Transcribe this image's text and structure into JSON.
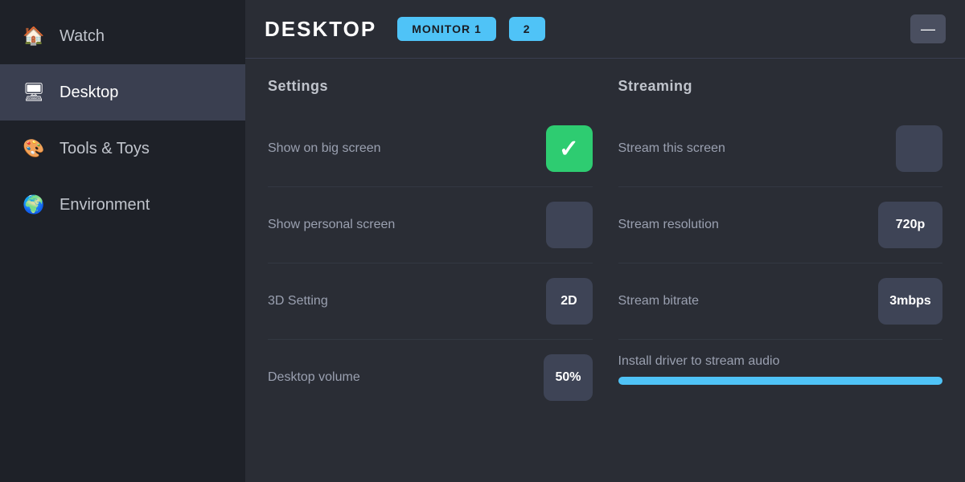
{
  "sidebar": {
    "items": [
      {
        "id": "watch",
        "label": "Watch",
        "icon": "🏠",
        "active": false
      },
      {
        "id": "desktop",
        "label": "Desktop",
        "icon": "🖥",
        "active": true
      },
      {
        "id": "tools",
        "label": "Tools & Toys",
        "icon": "🎨",
        "active": false
      },
      {
        "id": "environment",
        "label": "Environment",
        "icon": "🌍",
        "active": false
      }
    ]
  },
  "header": {
    "title": "DESKTOP",
    "monitor1_label": "MONITOR 1",
    "monitor2_label": "2",
    "minimize_icon": "—"
  },
  "settings": {
    "panel_title": "Settings",
    "rows": [
      {
        "id": "show-big-screen",
        "label": "Show on big screen",
        "type": "checkbox-checked"
      },
      {
        "id": "show-personal-screen",
        "label": "Show personal screen",
        "type": "checkbox-empty"
      },
      {
        "id": "3d-setting",
        "label": "3D Setting",
        "type": "value",
        "value": "2D"
      },
      {
        "id": "desktop-volume",
        "label": "Desktop volume",
        "type": "value",
        "value": "50%"
      }
    ]
  },
  "streaming": {
    "panel_title": "Streaming",
    "rows": [
      {
        "id": "stream-this-screen",
        "label": "Stream this screen",
        "type": "checkbox-empty"
      },
      {
        "id": "stream-resolution",
        "label": "Stream resolution",
        "type": "value",
        "value": "720p"
      },
      {
        "id": "stream-bitrate",
        "label": "Stream bitrate",
        "type": "value",
        "value": "3mbps"
      },
      {
        "id": "install-driver",
        "label": "Install driver to stream audio",
        "type": "install-bar"
      }
    ]
  }
}
